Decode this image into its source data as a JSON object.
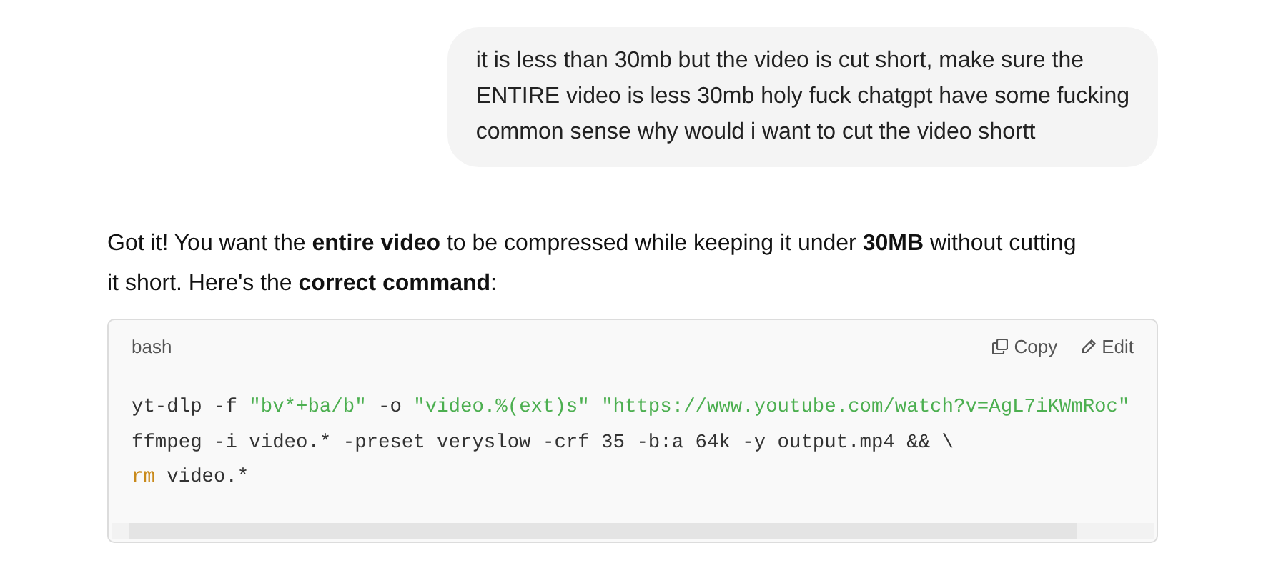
{
  "user_message": {
    "lines": [
      "it is less than 30mb but the video is cut short, make sure the",
      "ENTIRE video is less 30mb holy fuck chatgpt have some fucking",
      "common sense why would i want to cut the video shortt"
    ]
  },
  "assistant_message": {
    "lines": [
      "Got it! You want the **entire video** to be compressed while keeping it under **30MB** without cutting",
      "it short. Here's the **correct command**:"
    ]
  },
  "code_block": {
    "language": "bash",
    "actions": [
      {
        "label": "Copy",
        "kind": "copy"
      },
      {
        "label": "Edit",
        "kind": "edit"
      }
    ],
    "lines": [
      {
        "tokens": [
          {
            "text": "yt-dlp -f ",
            "kind": "plain"
          },
          {
            "text": "\"bv*+ba/b\"",
            "kind": "string"
          },
          {
            "text": " -o ",
            "kind": "plain"
          },
          {
            "text": "\"video.%(ext)s\"",
            "kind": "string"
          },
          {
            "text": " \"https://www.youtube.com/watch?v=AgL7iKWmRoc\"",
            "kind": "string"
          }
        ]
      },
      {
        "tokens": [
          {
            "text": "ffmpeg -i video.* -preset veryslow -crf 35 -b:a 64k -y output.mp4 && \\",
            "kind": "plain"
          }
        ]
      },
      {
        "tokens": [
          {
            "text": "rm",
            "kind": "keyword"
          },
          {
            "text": " video.*",
            "kind": "plain"
          }
        ]
      }
    ]
  }
}
